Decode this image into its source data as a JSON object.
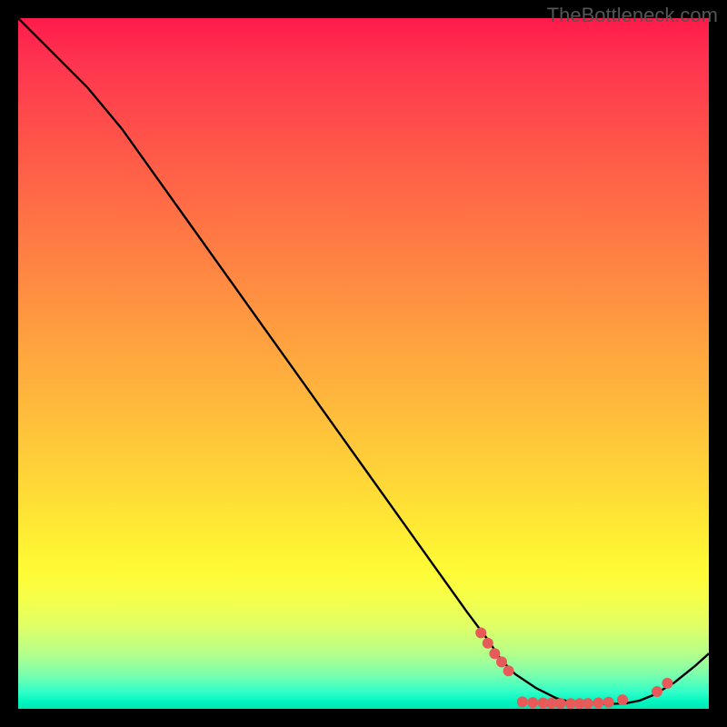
{
  "watermark": "TheBottleneck.com",
  "chart_data": {
    "type": "line",
    "title": "",
    "xlabel": "",
    "ylabel": "",
    "xlim": [
      0,
      100
    ],
    "ylim": [
      0,
      100
    ],
    "series": [
      {
        "name": "curve",
        "x": [
          0,
          5,
          10,
          15,
          20,
          25,
          30,
          35,
          40,
          45,
          50,
          55,
          60,
          65,
          68,
          70,
          72,
          75,
          78,
          80,
          82,
          85,
          88,
          90,
          92,
          95,
          98,
          100
        ],
        "y": [
          100,
          95,
          90,
          84,
          77,
          70,
          63,
          56,
          49,
          42,
          35,
          28,
          21,
          14,
          10,
          7,
          5,
          3,
          1.5,
          1,
          0.8,
          0.7,
          0.8,
          1.2,
          2,
          3.8,
          6.2,
          8
        ]
      }
    ],
    "markers": [
      {
        "x": 67,
        "y": 11
      },
      {
        "x": 68,
        "y": 9.5
      },
      {
        "x": 69,
        "y": 8
      },
      {
        "x": 70,
        "y": 6.8
      },
      {
        "x": 71,
        "y": 5.5
      },
      {
        "x": 73,
        "y": 1.0
      },
      {
        "x": 74.5,
        "y": 0.9
      },
      {
        "x": 76,
        "y": 0.85
      },
      {
        "x": 77.2,
        "y": 0.8
      },
      {
        "x": 78.5,
        "y": 0.78
      },
      {
        "x": 80,
        "y": 0.75
      },
      {
        "x": 81.3,
        "y": 0.75
      },
      {
        "x": 82.5,
        "y": 0.78
      },
      {
        "x": 84,
        "y": 0.85
      },
      {
        "x": 85.5,
        "y": 0.95
      },
      {
        "x": 87.5,
        "y": 1.3
      },
      {
        "x": 92.5,
        "y": 2.5
      },
      {
        "x": 94,
        "y": 3.7
      }
    ],
    "colors": {
      "curve": "#000000",
      "markers": "#e85a5a"
    }
  }
}
